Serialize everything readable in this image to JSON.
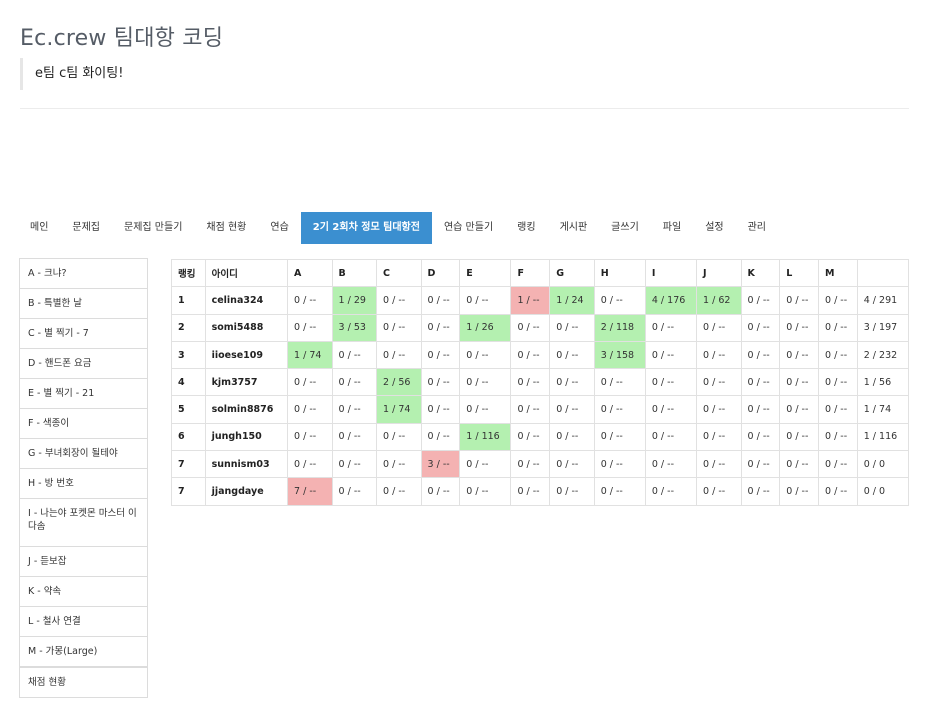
{
  "header": {
    "title": "Ec.crew 팀대항 코딩",
    "subtitle": "e팀 c팀 화이팅!"
  },
  "tabs": [
    {
      "label": "메인"
    },
    {
      "label": "문제집"
    },
    {
      "label": "문제집 만들기"
    },
    {
      "label": "채점 현황"
    },
    {
      "label": "연습"
    },
    {
      "label": "2기 2회차 정모 팀대항전",
      "active": true
    },
    {
      "label": "연습 만들기"
    },
    {
      "label": "랭킹"
    },
    {
      "label": "게시판"
    },
    {
      "label": "글쓰기"
    },
    {
      "label": "파일"
    },
    {
      "label": "설정"
    },
    {
      "label": "관리"
    }
  ],
  "problems": [
    {
      "label": "A - 크냐?"
    },
    {
      "label": "B - 특별한 날"
    },
    {
      "label": "C - 별 찍기 - 7"
    },
    {
      "label": "D - 핸드폰 요금"
    },
    {
      "label": "E - 별 찍기 - 21"
    },
    {
      "label": "F - 색종이"
    },
    {
      "label": "G - 부녀회장이 될테야"
    },
    {
      "label": "H - 방 번호"
    },
    {
      "label": "I - 나는야 포켓몬 마스터 이다솜"
    },
    {
      "label": "J - 듣보잡"
    },
    {
      "label": "K - 약속"
    },
    {
      "label": "L - 철사 연결"
    },
    {
      "label": "M - 가몽(Large)"
    }
  ],
  "sidebar_bottom": {
    "label": "채점 현황"
  },
  "table": {
    "headers": [
      "랭킹",
      "아이디",
      "A",
      "B",
      "C",
      "D",
      "E",
      "F",
      "G",
      "H",
      "I",
      "J",
      "K",
      "L",
      "M",
      ""
    ],
    "rows": [
      {
        "rank": "1",
        "id": "celina324",
        "total": "4 / 291",
        "cells": [
          {
            "v": "0 / --"
          },
          {
            "v": "1 / 29",
            "s": "solved"
          },
          {
            "v": "0 / --"
          },
          {
            "v": "0 / --"
          },
          {
            "v": "0 / --"
          },
          {
            "v": "1 / --",
            "s": "failed"
          },
          {
            "v": "1 / 24",
            "s": "solved"
          },
          {
            "v": "0 / --"
          },
          {
            "v": "4 / 176",
            "s": "solved"
          },
          {
            "v": "1 / 62",
            "s": "solved"
          },
          {
            "v": "0 / --"
          },
          {
            "v": "0 / --"
          },
          {
            "v": "0 / --"
          }
        ]
      },
      {
        "rank": "2",
        "id": "somi5488",
        "total": "3 / 197",
        "cells": [
          {
            "v": "0 / --"
          },
          {
            "v": "3 / 53",
            "s": "solved"
          },
          {
            "v": "0 / --"
          },
          {
            "v": "0 / --"
          },
          {
            "v": "1 / 26",
            "s": "solved"
          },
          {
            "v": "0 / --"
          },
          {
            "v": "0 / --"
          },
          {
            "v": "2 / 118",
            "s": "solved"
          },
          {
            "v": "0 / --"
          },
          {
            "v": "0 / --"
          },
          {
            "v": "0 / --"
          },
          {
            "v": "0 / --"
          },
          {
            "v": "0 / --"
          }
        ]
      },
      {
        "rank": "3",
        "id": "iioese109",
        "total": "2 / 232",
        "cells": [
          {
            "v": "1 / 74",
            "s": "solved"
          },
          {
            "v": "0 / --"
          },
          {
            "v": "0 / --"
          },
          {
            "v": "0 / --"
          },
          {
            "v": "0 / --"
          },
          {
            "v": "0 / --"
          },
          {
            "v": "0 / --"
          },
          {
            "v": "3 / 158",
            "s": "solved"
          },
          {
            "v": "0 / --"
          },
          {
            "v": "0 / --"
          },
          {
            "v": "0 / --"
          },
          {
            "v": "0 / --"
          },
          {
            "v": "0 / --"
          }
        ]
      },
      {
        "rank": "4",
        "id": "kjm3757",
        "total": "1 / 56",
        "cells": [
          {
            "v": "0 / --"
          },
          {
            "v": "0 / --"
          },
          {
            "v": "2 / 56",
            "s": "solved"
          },
          {
            "v": "0 / --"
          },
          {
            "v": "0 / --"
          },
          {
            "v": "0 / --"
          },
          {
            "v": "0 / --"
          },
          {
            "v": "0 / --"
          },
          {
            "v": "0 / --"
          },
          {
            "v": "0 / --"
          },
          {
            "v": "0 / --"
          },
          {
            "v": "0 / --"
          },
          {
            "v": "0 / --"
          }
        ]
      },
      {
        "rank": "5",
        "id": "solmin8876",
        "total": "1 / 74",
        "cells": [
          {
            "v": "0 / --"
          },
          {
            "v": "0 / --"
          },
          {
            "v": "1 / 74",
            "s": "solved"
          },
          {
            "v": "0 / --"
          },
          {
            "v": "0 / --"
          },
          {
            "v": "0 / --"
          },
          {
            "v": "0 / --"
          },
          {
            "v": "0 / --"
          },
          {
            "v": "0 / --"
          },
          {
            "v": "0 / --"
          },
          {
            "v": "0 / --"
          },
          {
            "v": "0 / --"
          },
          {
            "v": "0 / --"
          }
        ]
      },
      {
        "rank": "6",
        "id": "jungh150",
        "total": "1 / 116",
        "cells": [
          {
            "v": "0 / --"
          },
          {
            "v": "0 / --"
          },
          {
            "v": "0 / --"
          },
          {
            "v": "0 / --"
          },
          {
            "v": "1 / 116",
            "s": "solved"
          },
          {
            "v": "0 / --"
          },
          {
            "v": "0 / --"
          },
          {
            "v": "0 / --"
          },
          {
            "v": "0 / --"
          },
          {
            "v": "0 / --"
          },
          {
            "v": "0 / --"
          },
          {
            "v": "0 / --"
          },
          {
            "v": "0 / --"
          }
        ]
      },
      {
        "rank": "7",
        "id": "sunnism03",
        "total": "0 / 0",
        "cells": [
          {
            "v": "0 / --"
          },
          {
            "v": "0 / --"
          },
          {
            "v": "0 / --"
          },
          {
            "v": "3 / --",
            "s": "failed"
          },
          {
            "v": "0 / --"
          },
          {
            "v": "0 / --"
          },
          {
            "v": "0 / --"
          },
          {
            "v": "0 / --"
          },
          {
            "v": "0 / --"
          },
          {
            "v": "0 / --"
          },
          {
            "v": "0 / --"
          },
          {
            "v": "0 / --"
          },
          {
            "v": "0 / --"
          }
        ]
      },
      {
        "rank": "7",
        "id": "jjangdaye",
        "total": "0 / 0",
        "cells": [
          {
            "v": "7 / --",
            "s": "failed"
          },
          {
            "v": "0 / --"
          },
          {
            "v": "0 / --"
          },
          {
            "v": "0 / --"
          },
          {
            "v": "0 / --"
          },
          {
            "v": "0 / --"
          },
          {
            "v": "0 / --"
          },
          {
            "v": "0 / --"
          },
          {
            "v": "0 / --"
          },
          {
            "v": "0 / --"
          },
          {
            "v": "0 / --"
          },
          {
            "v": "0 / --"
          },
          {
            "v": "0 / --"
          }
        ]
      }
    ]
  },
  "colors": {
    "accent": "#3b8fd0",
    "solved": "#b4f0b0",
    "failed": "#f4b2b2"
  }
}
